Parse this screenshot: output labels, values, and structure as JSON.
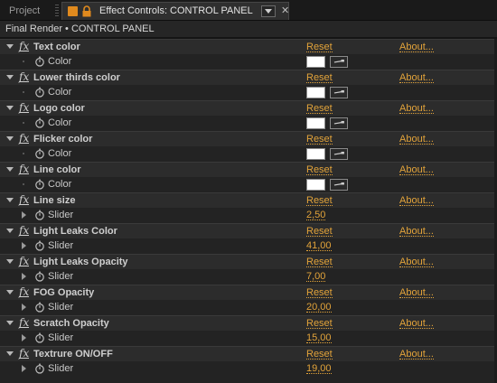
{
  "tabs": {
    "project": "Project",
    "active": "Effect Controls: CONTROL PANEL"
  },
  "breadcrumb": "Final Render • CONTROL PANEL",
  "colors": {
    "accent": "#e2a33a",
    "tab_icon": "#e08a1e",
    "swatch": "#ffffff"
  },
  "reset_label": "Reset",
  "about_label": "About...",
  "effects": [
    {
      "name": "Text color",
      "prop": "Color",
      "type": "color"
    },
    {
      "name": "Lower thirds color",
      "prop": "Color",
      "type": "color"
    },
    {
      "name": "Logo color",
      "prop": "Color",
      "type": "color"
    },
    {
      "name": "Flicker color",
      "prop": "Color",
      "type": "color"
    },
    {
      "name": "Line color",
      "prop": "Color",
      "type": "color"
    },
    {
      "name": "Line size",
      "prop": "Slider",
      "type": "slider",
      "value": "2,50"
    },
    {
      "name": "Light Leaks Color",
      "prop": "Slider",
      "type": "slider",
      "value": "41,00"
    },
    {
      "name": "Light Leaks Opacity",
      "prop": "Slider",
      "type": "slider",
      "value": "7,00"
    },
    {
      "name": "FOG Opacity",
      "prop": "Slider",
      "type": "slider",
      "value": "20,00"
    },
    {
      "name": "Scratch Opacity",
      "prop": "Slider",
      "type": "slider",
      "value": "15,00"
    },
    {
      "name": "Textrure ON/OFF",
      "prop": "Slider",
      "type": "slider",
      "value": "19,00"
    }
  ]
}
